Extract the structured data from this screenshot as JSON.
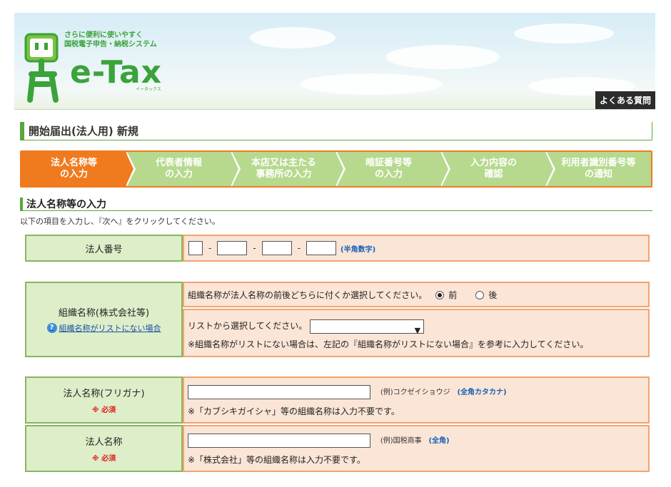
{
  "header": {
    "tagline_line1": "さらに便利に使いやすく",
    "tagline_line2": "国税電子申告・納税システム",
    "brand": "e-Tax",
    "brand_sub": "イータックス",
    "faq_label": "よくある質問"
  },
  "page_title": "開始届出(法人用) 新規",
  "steps": [
    {
      "line1": "法人名称等",
      "line2": "の入力",
      "active": true
    },
    {
      "line1": "代表者情報",
      "line2": "の入力",
      "active": false
    },
    {
      "line1": "本店又は主たる",
      "line2": "事務所の入力",
      "active": false
    },
    {
      "line1": "暗証番号等",
      "line2": "の入力",
      "active": false
    },
    {
      "line1": "入力内容の",
      "line2": "確認",
      "active": false
    },
    {
      "line1": "利用者識別番号等",
      "line2": "の通知",
      "active": false
    }
  ],
  "section_title": "法人名称等の入力",
  "instruction": "以下の項目を入力し、『次へ』をクリックしてください。",
  "corp_number": {
    "label": "法人番号",
    "values": [
      "",
      "",
      "",
      ""
    ],
    "separator": "-",
    "hint": "(半角数字)"
  },
  "org_name": {
    "label": "組織名称(株式会社等)",
    "help_link": "組織名称がリストにない場合",
    "position_prompt": "組織名称が法人名称の前後どちらに付くか選択してください。",
    "position_options": [
      "前",
      "後"
    ],
    "position_selected": "前",
    "list_prompt": "リストから選択してください。",
    "list_selected": "",
    "note": "※組織名称がリストにない場合は、左記の『組織名称がリストにない場合』を参考に入力してください。"
  },
  "furigana": {
    "label": "法人名称(フリガナ)",
    "required": "※ 必須",
    "value": "",
    "example": "(例)コクゼイショウジ",
    "hint": "(全角カタカナ)",
    "note": "※「カブシキガイシャ」等の組織名称は入力不要です。"
  },
  "corp_name": {
    "label": "法人名称",
    "required": "※ 必須",
    "value": "",
    "example": "(例)国税商事",
    "hint": "(全角)",
    "note": "※「株式会社」等の組織名称は入力不要です。"
  },
  "colors": {
    "brand_green": "#3aa33a",
    "step_active": "#f07b1f",
    "step_inactive": "#b6d98e",
    "label_bg": "#ddeec9",
    "value_bg": "#fbe5d6"
  }
}
